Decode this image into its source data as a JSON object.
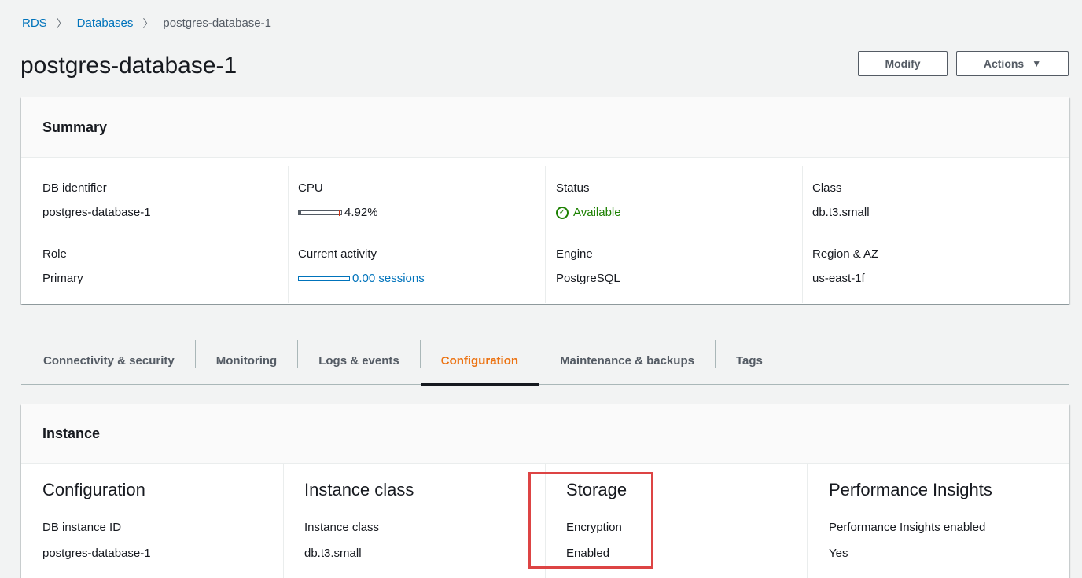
{
  "breadcrumb": {
    "rds": "RDS",
    "databases": "Databases",
    "current": "postgres-database-1",
    "separator": ">"
  },
  "page": {
    "title": "postgres-database-1",
    "modify_label": "Modify",
    "actions_label": "Actions",
    "actions_caret": "▼"
  },
  "summary": {
    "title": "Summary",
    "db_identifier_label": "DB identifier",
    "db_identifier_value": "postgres-database-1",
    "role_label": "Role",
    "role_value": "Primary",
    "cpu_label": "CPU",
    "cpu_value": "4.92%",
    "cpu_fraction": 0.0492,
    "activity_label": "Current activity",
    "activity_value": "0.00 sessions",
    "status_label": "Status",
    "status_value": "Available",
    "engine_label": "Engine",
    "engine_value": "PostgreSQL",
    "class_label": "Class",
    "class_value": "db.t3.small",
    "region_label": "Region & AZ",
    "region_value": "us-east-1f"
  },
  "tabs": [
    {
      "label": "Connectivity & security",
      "active": false
    },
    {
      "label": "Monitoring",
      "active": false
    },
    {
      "label": "Logs & events",
      "active": false
    },
    {
      "label": "Configuration",
      "active": true
    },
    {
      "label": "Maintenance & backups",
      "active": false
    },
    {
      "label": "Tags",
      "active": false
    }
  ],
  "instance": {
    "title": "Instance",
    "configuration": {
      "heading": "Configuration",
      "label": "DB instance ID",
      "value": "postgres-database-1"
    },
    "instance_class": {
      "heading": "Instance class",
      "label": "Instance class",
      "value": "db.t3.small"
    },
    "storage": {
      "heading": "Storage",
      "label": "Encryption",
      "value": "Enabled"
    },
    "performance": {
      "heading": "Performance Insights",
      "label": "Performance Insights enabled",
      "value": "Yes"
    }
  },
  "colors": {
    "link": "#0073bb",
    "active_tab": "#ec7211",
    "status_ok": "#1d8102",
    "highlight": "#dd4444"
  }
}
